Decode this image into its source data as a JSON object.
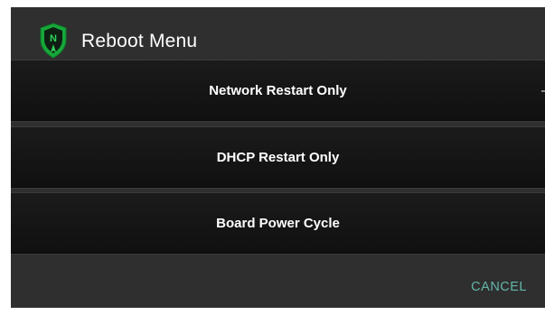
{
  "dialog": {
    "title": "Reboot Menu",
    "logo": {
      "icon": "shield-compass-icon",
      "letter": "N",
      "shield_color": "#16a83a"
    },
    "buttons": [
      {
        "label": "Network Restart Only"
      },
      {
        "label": "DHCP Restart Only"
      },
      {
        "label": "Board Power Cycle"
      }
    ],
    "cancel_label": "CANCEL",
    "colors": {
      "background": "#2f2f2f",
      "button": "#141414",
      "accent": "#63b6a8"
    }
  }
}
